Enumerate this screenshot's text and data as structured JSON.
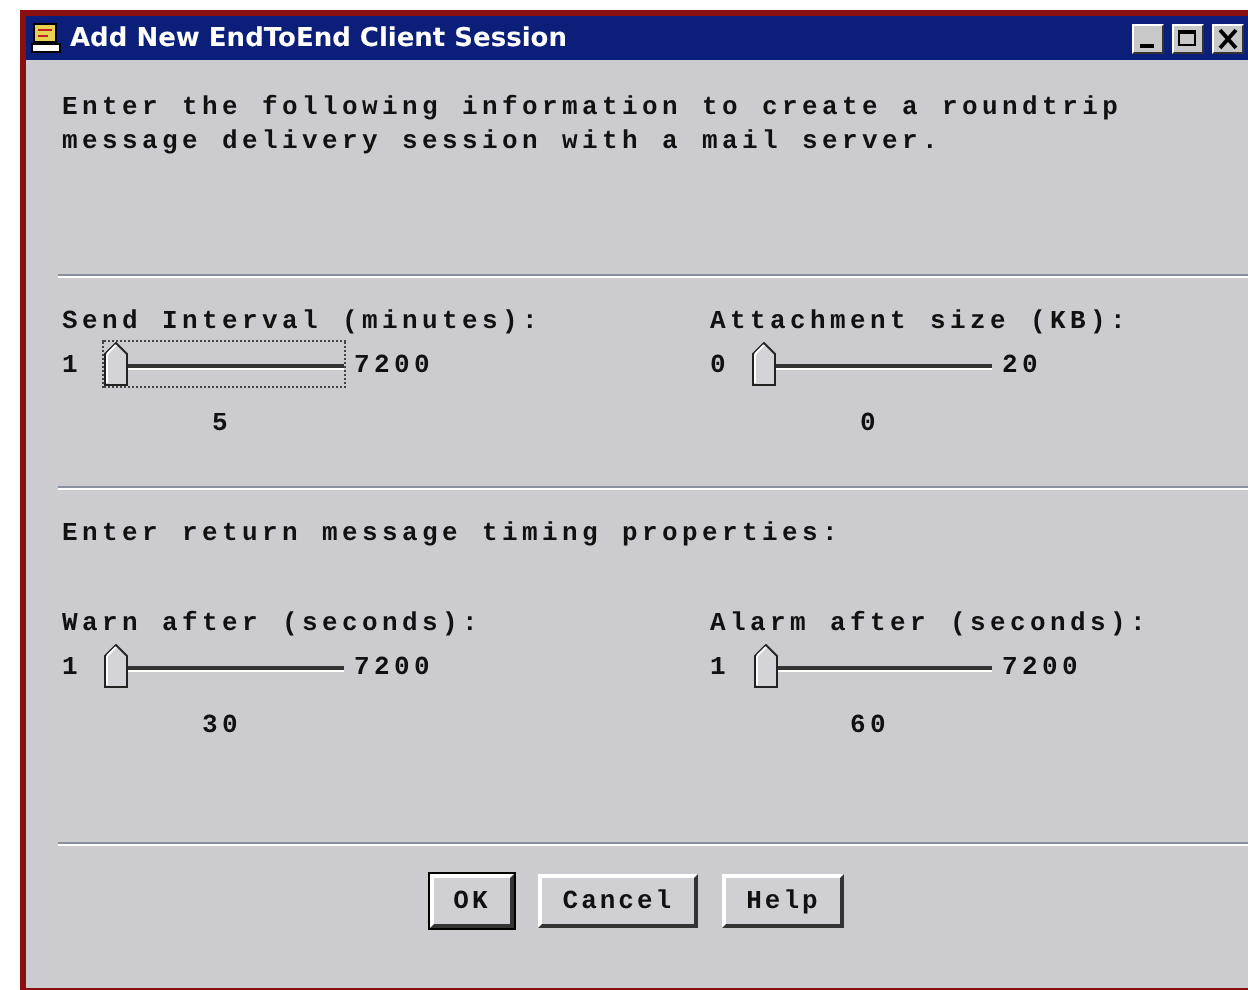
{
  "window": {
    "title": "Add New EndToEnd Client Session"
  },
  "intro": "Enter the following information to create a roundtrip\nmessage delivery session with a mail server.",
  "sections": [
    {
      "sliders": [
        {
          "label": "Send Interval (minutes):",
          "min": "1",
          "max": "7200",
          "value": "5",
          "level": 0.001,
          "focused": true
        },
        {
          "label": "Attachment size (KB):",
          "min": "0",
          "max": "20",
          "value": "0",
          "level": 0,
          "focused": false
        }
      ]
    },
    {
      "heading": "Enter return message timing properties:",
      "sliders": [
        {
          "label": "Warn after  (seconds):",
          "min": "1",
          "max": "7200",
          "value": "30",
          "level": 0.004,
          "focused": false
        },
        {
          "label": "Alarm after (seconds):",
          "min": "1",
          "max": "7200",
          "value": "60",
          "level": 0.008,
          "focused": false
        }
      ]
    }
  ],
  "buttons": [
    {
      "label": "OK",
      "default": true
    },
    {
      "label": "Cancel",
      "default": false
    },
    {
      "label": "Help",
      "default": false
    }
  ]
}
